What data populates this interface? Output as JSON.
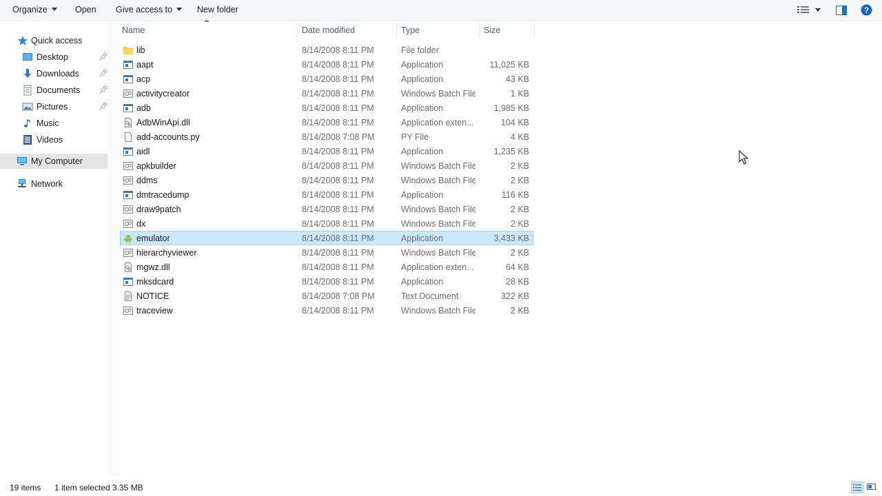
{
  "toolbar": {
    "organize": "Organize",
    "open": "Open",
    "give_access": "Give access to",
    "new_folder": "New folder",
    "icons": [
      "view-options-icon",
      "preview-pane-icon",
      "help-icon"
    ]
  },
  "nav": {
    "items": [
      {
        "label": "Quick access",
        "icon": "star-icon"
      },
      {
        "label": "Desktop",
        "icon": "desktop-icon",
        "pinned": true
      },
      {
        "label": "Downloads",
        "icon": "download-icon",
        "pinned": true
      },
      {
        "label": "Documents",
        "icon": "documents-icon",
        "pinned": true
      },
      {
        "label": "Pictures",
        "icon": "pictures-icon",
        "pinned": true
      },
      {
        "label": "Music",
        "icon": "music-icon"
      },
      {
        "label": "Videos",
        "icon": "videos-icon"
      },
      {
        "label": "My Computer",
        "icon": "computer-icon",
        "selected": true
      },
      {
        "label": "Network",
        "icon": "network-icon"
      }
    ]
  },
  "columns": {
    "name": "Name",
    "date": "Date modified",
    "type": "Type",
    "size": "Size"
  },
  "files": [
    {
      "name": "lib",
      "date": "8/14/2008 8:11 PM",
      "type": "File folder",
      "size": "",
      "icon": "folder-icon"
    },
    {
      "name": "aapt",
      "date": "8/14/2008 8:11 PM",
      "type": "Application",
      "size": "11,025 KB",
      "icon": "application-icon"
    },
    {
      "name": "acp",
      "date": "8/14/2008 8:11 PM",
      "type": "Application",
      "size": "43 KB",
      "icon": "application-icon"
    },
    {
      "name": "activitycreator",
      "date": "8/14/2008 8:11 PM",
      "type": "Windows Batch File",
      "size": "1 KB",
      "icon": "batch-file-icon"
    },
    {
      "name": "adb",
      "date": "8/14/2008 8:11 PM",
      "type": "Application",
      "size": "1,985 KB",
      "icon": "application-icon"
    },
    {
      "name": "AdbWinApi.dll",
      "date": "8/14/2008 8:11 PM",
      "type": "Application exten...",
      "size": "104 KB",
      "icon": "dll-icon"
    },
    {
      "name": "add-accounts.py",
      "date": "8/14/2008 7:08 PM",
      "type": "PY File",
      "size": "4 KB",
      "icon": "generic-file-icon"
    },
    {
      "name": "aidl",
      "date": "8/14/2008 8:11 PM",
      "type": "Application",
      "size": "1,235 KB",
      "icon": "application-icon"
    },
    {
      "name": "apkbuilder",
      "date": "8/14/2008 8:11 PM",
      "type": "Windows Batch File",
      "size": "2 KB",
      "icon": "batch-file-icon"
    },
    {
      "name": "ddms",
      "date": "8/14/2008 8:11 PM",
      "type": "Windows Batch File",
      "size": "2 KB",
      "icon": "batch-file-icon"
    },
    {
      "name": "dmtracedump",
      "date": "8/14/2008 8:11 PM",
      "type": "Application",
      "size": "116 KB",
      "icon": "application-icon"
    },
    {
      "name": "draw9patch",
      "date": "8/14/2008 8:11 PM",
      "type": "Windows Batch File",
      "size": "2 KB",
      "icon": "batch-file-icon"
    },
    {
      "name": "dx",
      "date": "8/14/2008 8:11 PM",
      "type": "Windows Batch File",
      "size": "2 KB",
      "icon": "batch-file-icon"
    },
    {
      "name": "emulator",
      "date": "8/14/2008 8:11 PM",
      "type": "Application",
      "size": "3,433 KB",
      "icon": "android-icon",
      "selected": true
    },
    {
      "name": "hierarchyviewer",
      "date": "8/14/2008 8:11 PM",
      "type": "Windows Batch File",
      "size": "2 KB",
      "icon": "batch-file-icon"
    },
    {
      "name": "mgwz.dll",
      "date": "8/14/2008 8:11 PM",
      "type": "Application exten...",
      "size": "64 KB",
      "icon": "dll-icon"
    },
    {
      "name": "mksdcard",
      "date": "8/14/2008 8:11 PM",
      "type": "Application",
      "size": "28 KB",
      "icon": "application-icon"
    },
    {
      "name": "NOTICE",
      "date": "8/14/2008 7:08 PM",
      "type": "Text Document",
      "size": "322 KB",
      "icon": "text-document-icon"
    },
    {
      "name": "traceview",
      "date": "8/14/2008 8:11 PM",
      "type": "Windows Batch File",
      "size": "2 KB",
      "icon": "batch-file-icon"
    }
  ],
  "status": {
    "item_count": "19 items",
    "selection": "1 item selected",
    "selection_size": "3.35 MB"
  },
  "colors": {
    "selection_bg": "#cce8ff",
    "selection_border": "#99d1ff",
    "header_text": "#4c607a",
    "secondary_text": "#6d6d6d"
  }
}
